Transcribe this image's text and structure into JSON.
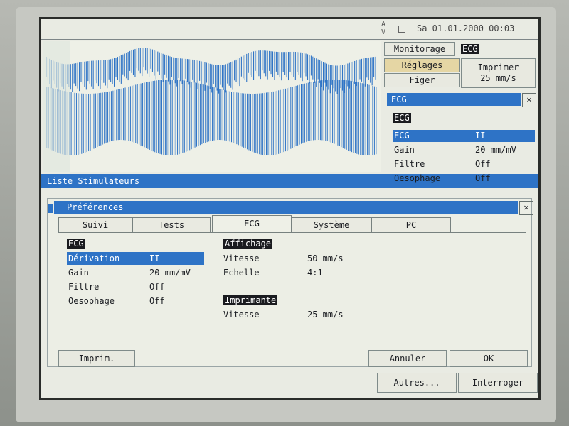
{
  "status": {
    "av": "A V",
    "datetime": "Sa 01.01.2000 00:03"
  },
  "list_header": "Liste Stimulateurs",
  "controls": {
    "monitorage": "Monitorage",
    "ecg_chip": "ECG",
    "reglages": "Réglages",
    "figer": "Figer",
    "imprimer": "Imprimer",
    "speed": "25 mm/s"
  },
  "side_panel": {
    "title": "ECG",
    "section": "ECG",
    "rows": [
      {
        "label": "ECG",
        "value": "II"
      },
      {
        "label": "Gain",
        "value": "20 mm/mV"
      },
      {
        "label": "Filtre",
        "value": "Off"
      },
      {
        "label": "Oesophage",
        "value": "Off"
      }
    ]
  },
  "preferences": {
    "title": "Préférences",
    "tabs": [
      "Suivi",
      "Tests",
      "ECG",
      "Système",
      "PC"
    ],
    "ecg": {
      "section": "ECG",
      "rows": [
        {
          "label": "Dérivation",
          "value": "II"
        },
        {
          "label": "Gain",
          "value": "20 mm/mV"
        },
        {
          "label": "Filtre",
          "value": "Off"
        },
        {
          "label": "Oesophage",
          "value": "Off"
        }
      ]
    },
    "affichage": {
      "section": "Affichage",
      "rows": [
        {
          "label": "Vitesse",
          "value": "50 mm/s"
        },
        {
          "label": "Echelle",
          "value": "4:1"
        }
      ]
    },
    "imprimante": {
      "section": "Imprimante",
      "rows": [
        {
          "label": "Vitesse",
          "value": "25 mm/s"
        }
      ]
    },
    "buttons": {
      "imprim": "Imprim.",
      "annuler": "Annuler",
      "ok": "OK"
    }
  },
  "bottom_buttons": {
    "autres": "Autres...",
    "interroger": "Interroger"
  },
  "colors": {
    "accent": "#2e73c6",
    "wave": "#2f74c6",
    "background": "#e9ebe3"
  }
}
